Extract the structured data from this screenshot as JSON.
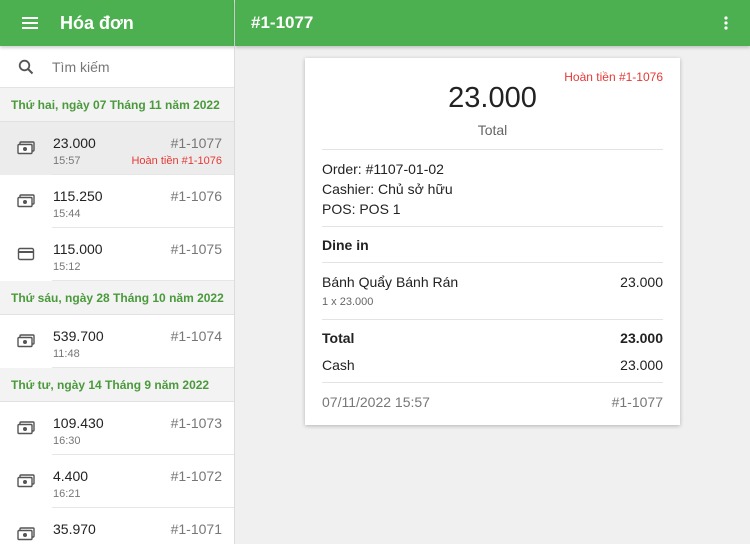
{
  "app": {
    "title": "Hóa đơn",
    "detail_title": "#1-1077"
  },
  "search": {
    "placeholder": "Tìm kiếm"
  },
  "groups": [
    {
      "date": "Thứ hai, ngày 07 Tháng 11 năm 2022",
      "rows": [
        {
          "amount": "23.000",
          "time": "15:57",
          "number": "#1-1077",
          "refund": "Hoàn tiền #1-1076",
          "icon": "cash-icon",
          "selected": true
        },
        {
          "amount": "115.250",
          "time": "15:44",
          "number": "#1-1076",
          "refund": "",
          "icon": "cash-icon"
        },
        {
          "amount": "115.000",
          "time": "15:12",
          "number": "#1-1075",
          "refund": "",
          "icon": "card-icon"
        }
      ]
    },
    {
      "date": "Thứ sáu, ngày 28 Tháng 10 năm 2022",
      "rows": [
        {
          "amount": "539.700",
          "time": "11:48",
          "number": "#1-1074",
          "refund": "",
          "icon": "cash-icon"
        }
      ]
    },
    {
      "date": "Thứ tư, ngày 14 Tháng 9 năm 2022",
      "rows": [
        {
          "amount": "109.430",
          "time": "16:30",
          "number": "#1-1073",
          "refund": "",
          "icon": "cash-icon"
        },
        {
          "amount": "4.400",
          "time": "16:21",
          "number": "#1-1072",
          "refund": "",
          "icon": "cash-icon"
        },
        {
          "amount": "35.970",
          "time": "",
          "number": "#1-1071",
          "refund": "",
          "icon": "cash-icon"
        }
      ]
    }
  ],
  "receipt": {
    "refund_label": "Hoàn tiền #1-1076",
    "total_amount": "23.000",
    "total_label": "Total",
    "order": "Order: #1107-01-02",
    "cashier": "Cashier: Chủ sở hữu",
    "pos": "POS: POS 1",
    "dining": "Dine in",
    "item_name": "Bánh Quẩy Bánh Rán",
    "item_price": "23.000",
    "item_qty": "1 x 23.000",
    "total_row_label": "Total",
    "total_row_value": "23.000",
    "payment_label": "Cash",
    "payment_value": "23.000",
    "datetime": "07/11/2022 15:57",
    "receipt_number": "#1-1077"
  },
  "colors": {
    "accent": "#4caf50",
    "date_header_text": "#4a9a3c",
    "refund": "#e53935"
  }
}
